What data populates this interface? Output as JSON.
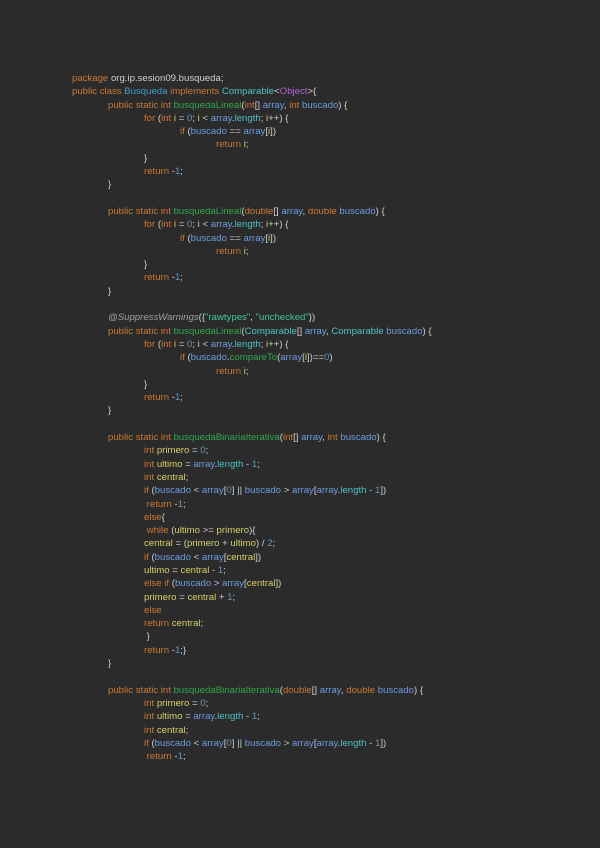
{
  "code_lines": [
    [
      [
        "k",
        "package "
      ],
      [
        "d",
        "org.ip.sesion09.busqueda;"
      ]
    ],
    [
      [
        "k",
        "public class "
      ],
      [
        "c",
        "Busqueda "
      ],
      [
        "k",
        "implements "
      ],
      [
        "t",
        "Comparable"
      ],
      [
        "d",
        "<"
      ],
      [
        "o",
        "Object"
      ],
      [
        "d",
        ">{"
      ]
    ],
    [
      [
        "k",
        "\tpublic static int "
      ],
      [
        "m",
        "busquedaLineal"
      ],
      [
        "d",
        "("
      ],
      [
        "k",
        "int"
      ],
      [
        "d",
        "[] "
      ],
      [
        "p",
        "array"
      ],
      [
        "d",
        ", "
      ],
      [
        "k",
        "int "
      ],
      [
        "p",
        "buscado"
      ],
      [
        "d",
        ") {"
      ]
    ],
    [
      [
        "k",
        "\t\tfor "
      ],
      [
        "d",
        "("
      ],
      [
        "k",
        "int "
      ],
      [
        "v",
        "i"
      ],
      [
        "d",
        " = "
      ],
      [
        "n",
        "0"
      ],
      [
        "d",
        "; "
      ],
      [
        "v",
        "i"
      ],
      [
        "d",
        " < "
      ],
      [
        "p",
        "array"
      ],
      [
        "d",
        "."
      ],
      [
        "f",
        "length"
      ],
      [
        "d",
        "; "
      ],
      [
        "v",
        "i"
      ],
      [
        "d",
        "++) {"
      ]
    ],
    [
      [
        "k",
        "\t\t\tif "
      ],
      [
        "d",
        "("
      ],
      [
        "p",
        "buscado"
      ],
      [
        "d",
        " == "
      ],
      [
        "p",
        "array"
      ],
      [
        "d",
        "["
      ],
      [
        "v",
        "i"
      ],
      [
        "d",
        "])"
      ]
    ],
    [
      [
        "k",
        "\t\t\t\treturn "
      ],
      [
        "v",
        "i"
      ],
      [
        "d",
        ";"
      ]
    ],
    [
      [
        "d",
        "\t\t}"
      ]
    ],
    [
      [
        "k",
        "\t\treturn "
      ],
      [
        "d",
        "-"
      ],
      [
        "n",
        "1"
      ],
      [
        "d",
        ";"
      ]
    ],
    [
      [
        "d",
        "\t}"
      ]
    ],
    [],
    [
      [
        "k",
        "\tpublic static int "
      ],
      [
        "m",
        "busquedaLineal"
      ],
      [
        "d",
        "("
      ],
      [
        "k",
        "double"
      ],
      [
        "d",
        "[] "
      ],
      [
        "p",
        "array"
      ],
      [
        "d",
        ", "
      ],
      [
        "k",
        "double "
      ],
      [
        "p",
        "buscado"
      ],
      [
        "d",
        ") {"
      ]
    ],
    [
      [
        "k",
        "\t\tfor "
      ],
      [
        "d",
        "("
      ],
      [
        "k",
        "int "
      ],
      [
        "v",
        "i"
      ],
      [
        "d",
        " = "
      ],
      [
        "n",
        "0"
      ],
      [
        "d",
        "; "
      ],
      [
        "v",
        "i"
      ],
      [
        "d",
        " < "
      ],
      [
        "p",
        "array"
      ],
      [
        "d",
        "."
      ],
      [
        "f",
        "length"
      ],
      [
        "d",
        "; "
      ],
      [
        "v",
        "i"
      ],
      [
        "d",
        "++) {"
      ]
    ],
    [
      [
        "k",
        "\t\t\tif "
      ],
      [
        "d",
        "("
      ],
      [
        "p",
        "buscado"
      ],
      [
        "d",
        " == "
      ],
      [
        "p",
        "array"
      ],
      [
        "d",
        "["
      ],
      [
        "v",
        "i"
      ],
      [
        "d",
        "])"
      ]
    ],
    [
      [
        "k",
        "\t\t\t\treturn "
      ],
      [
        "v",
        "i"
      ],
      [
        "d",
        ";"
      ]
    ],
    [
      [
        "d",
        "\t\t}"
      ]
    ],
    [
      [
        "k",
        "\t\treturn "
      ],
      [
        "d",
        "-"
      ],
      [
        "n",
        "1"
      ],
      [
        "d",
        ";"
      ]
    ],
    [
      [
        "d",
        "\t}"
      ]
    ],
    [],
    [
      [
        "a",
        "\t@SuppressWarnings"
      ],
      [
        "d",
        "({"
      ],
      [
        "s",
        "\"rawtypes\""
      ],
      [
        "d",
        ", "
      ],
      [
        "s",
        "\"unchecked\""
      ],
      [
        "d",
        "})"
      ]
    ],
    [
      [
        "k",
        "\tpublic static int "
      ],
      [
        "m",
        "busquedaLineal"
      ],
      [
        "d",
        "("
      ],
      [
        "t",
        "Comparable"
      ],
      [
        "d",
        "[] "
      ],
      [
        "p",
        "array"
      ],
      [
        "d",
        ", "
      ],
      [
        "t",
        "Comparable "
      ],
      [
        "p",
        "buscado"
      ],
      [
        "d",
        ") {"
      ]
    ],
    [
      [
        "k",
        "\t\tfor "
      ],
      [
        "d",
        "("
      ],
      [
        "k",
        "int "
      ],
      [
        "v",
        "i"
      ],
      [
        "d",
        " = "
      ],
      [
        "n",
        "0"
      ],
      [
        "d",
        "; "
      ],
      [
        "v",
        "i"
      ],
      [
        "d",
        " < "
      ],
      [
        "p",
        "array"
      ],
      [
        "d",
        "."
      ],
      [
        "f",
        "length"
      ],
      [
        "d",
        "; "
      ],
      [
        "v",
        "i"
      ],
      [
        "d",
        "++) {"
      ]
    ],
    [
      [
        "k",
        "\t\t\tif "
      ],
      [
        "d",
        "("
      ],
      [
        "p",
        "buscado"
      ],
      [
        "d",
        "."
      ],
      [
        "m",
        "compareTo"
      ],
      [
        "d",
        "("
      ],
      [
        "p",
        "array"
      ],
      [
        "d",
        "["
      ],
      [
        "v",
        "i"
      ],
      [
        "d",
        "])=="
      ],
      [
        "n",
        "0"
      ],
      [
        "d",
        ")"
      ]
    ],
    [
      [
        "k",
        "\t\t\t\treturn "
      ],
      [
        "v",
        "i"
      ],
      [
        "d",
        ";"
      ]
    ],
    [
      [
        "d",
        "\t\t}"
      ]
    ],
    [
      [
        "k",
        "\t\treturn "
      ],
      [
        "d",
        "-"
      ],
      [
        "n",
        "1"
      ],
      [
        "d",
        ";"
      ]
    ],
    [
      [
        "d",
        "\t}"
      ]
    ],
    [],
    [
      [
        "k",
        "\tpublic static int "
      ],
      [
        "m",
        "busquedaBinariaIterativa"
      ],
      [
        "d",
        "("
      ],
      [
        "k",
        "int"
      ],
      [
        "d",
        "[] "
      ],
      [
        "p",
        "array"
      ],
      [
        "d",
        ", "
      ],
      [
        "k",
        "int "
      ],
      [
        "p",
        "buscado"
      ],
      [
        "d",
        ") {"
      ]
    ],
    [
      [
        "k",
        "\t\tint "
      ],
      [
        "v",
        "primero"
      ],
      [
        "d",
        " = "
      ],
      [
        "n",
        "0"
      ],
      [
        "d",
        ";"
      ]
    ],
    [
      [
        "k",
        "\t\tint "
      ],
      [
        "v",
        "ultimo"
      ],
      [
        "d",
        " = "
      ],
      [
        "p",
        "array"
      ],
      [
        "d",
        "."
      ],
      [
        "f",
        "length"
      ],
      [
        "d",
        " - "
      ],
      [
        "n",
        "1"
      ],
      [
        "d",
        ";"
      ]
    ],
    [
      [
        "k",
        "\t\tint "
      ],
      [
        "v",
        "central"
      ],
      [
        "d",
        ";"
      ]
    ],
    [
      [
        "k",
        "\t\tif "
      ],
      [
        "d",
        "("
      ],
      [
        "p",
        "buscado"
      ],
      [
        "d",
        " < "
      ],
      [
        "p",
        "array"
      ],
      [
        "d",
        "["
      ],
      [
        "n",
        "0"
      ],
      [
        "d",
        "] || "
      ],
      [
        "p",
        "buscado"
      ],
      [
        "d",
        " > "
      ],
      [
        "p",
        "array"
      ],
      [
        "d",
        "["
      ],
      [
        "p",
        "array"
      ],
      [
        "d",
        "."
      ],
      [
        "f",
        "length"
      ],
      [
        "d",
        " - "
      ],
      [
        "n",
        "1"
      ],
      [
        "d",
        "])"
      ]
    ],
    [
      [
        "k",
        "\t\t return "
      ],
      [
        "d",
        "-"
      ],
      [
        "n",
        "1"
      ],
      [
        "d",
        ";"
      ]
    ],
    [
      [
        "k",
        "\t\telse"
      ],
      [
        "d",
        "{"
      ]
    ],
    [
      [
        "k",
        "\t\t while "
      ],
      [
        "d",
        "("
      ],
      [
        "v",
        "ultimo"
      ],
      [
        "d",
        " >= "
      ],
      [
        "v",
        "primero"
      ],
      [
        "d",
        "){"
      ]
    ],
    [
      [
        "v",
        "\t\tcentral"
      ],
      [
        "d",
        " = ("
      ],
      [
        "v",
        "primero"
      ],
      [
        "d",
        " + "
      ],
      [
        "v",
        "ultimo"
      ],
      [
        "d",
        ") / "
      ],
      [
        "n",
        "2"
      ],
      [
        "d",
        ";"
      ]
    ],
    [
      [
        "k",
        "\t\tif "
      ],
      [
        "d",
        "("
      ],
      [
        "p",
        "buscado"
      ],
      [
        "d",
        " < "
      ],
      [
        "p",
        "array"
      ],
      [
        "d",
        "["
      ],
      [
        "v",
        "central"
      ],
      [
        "d",
        "])"
      ]
    ],
    [
      [
        "v",
        "\t\tultimo"
      ],
      [
        "d",
        " = "
      ],
      [
        "v",
        "central"
      ],
      [
        "d",
        " - "
      ],
      [
        "n",
        "1"
      ],
      [
        "d",
        ";"
      ]
    ],
    [
      [
        "k",
        "\t\telse if "
      ],
      [
        "d",
        "("
      ],
      [
        "p",
        "buscado"
      ],
      [
        "d",
        " > "
      ],
      [
        "p",
        "array"
      ],
      [
        "d",
        "["
      ],
      [
        "v",
        "central"
      ],
      [
        "d",
        "])"
      ]
    ],
    [
      [
        "v",
        "\t\tprimero"
      ],
      [
        "d",
        " = "
      ],
      [
        "v",
        "central"
      ],
      [
        "d",
        " + "
      ],
      [
        "n",
        "1"
      ],
      [
        "d",
        ";"
      ]
    ],
    [
      [
        "k",
        "\t\telse"
      ]
    ],
    [
      [
        "k",
        "\t\treturn "
      ],
      [
        "v",
        "central"
      ],
      [
        "d",
        ";"
      ]
    ],
    [
      [
        "d",
        "\t\t }"
      ]
    ],
    [
      [
        "k",
        "\t\treturn "
      ],
      [
        "d",
        "-"
      ],
      [
        "n",
        "1"
      ],
      [
        "d",
        ";}"
      ]
    ],
    [
      [
        "d",
        "\t}"
      ]
    ],
    [],
    [
      [
        "k",
        "\tpublic static int "
      ],
      [
        "m",
        "busquedaBinariaIterativa"
      ],
      [
        "d",
        "("
      ],
      [
        "k",
        "double"
      ],
      [
        "d",
        "[] "
      ],
      [
        "p",
        "array"
      ],
      [
        "d",
        ", "
      ],
      [
        "k",
        "double "
      ],
      [
        "p",
        "buscado"
      ],
      [
        "d",
        ") {"
      ]
    ],
    [
      [
        "k",
        "\t\tint "
      ],
      [
        "v",
        "primero"
      ],
      [
        "d",
        " = "
      ],
      [
        "n",
        "0"
      ],
      [
        "d",
        ";"
      ]
    ],
    [
      [
        "k",
        "\t\tint "
      ],
      [
        "v",
        "ultimo"
      ],
      [
        "d",
        " = "
      ],
      [
        "p",
        "array"
      ],
      [
        "d",
        "."
      ],
      [
        "f",
        "length"
      ],
      [
        "d",
        " - "
      ],
      [
        "n",
        "1"
      ],
      [
        "d",
        ";"
      ]
    ],
    [
      [
        "k",
        "\t\tint "
      ],
      [
        "v",
        "central"
      ],
      [
        "d",
        ";"
      ]
    ],
    [
      [
        "k",
        "\t\tif "
      ],
      [
        "d",
        "("
      ],
      [
        "p",
        "buscado"
      ],
      [
        "d",
        " < "
      ],
      [
        "p",
        "array"
      ],
      [
        "d",
        "["
      ],
      [
        "n",
        "0"
      ],
      [
        "d",
        "] || "
      ],
      [
        "p",
        "buscado"
      ],
      [
        "d",
        " > "
      ],
      [
        "p",
        "array"
      ],
      [
        "d",
        "["
      ],
      [
        "p",
        "array"
      ],
      [
        "d",
        "."
      ],
      [
        "f",
        "length"
      ],
      [
        "d",
        " - "
      ],
      [
        "n",
        "1"
      ],
      [
        "d",
        "])"
      ]
    ],
    [
      [
        "k",
        "\t\t return "
      ],
      [
        "d",
        "-"
      ],
      [
        "n",
        "1"
      ],
      [
        "d",
        ";"
      ]
    ]
  ],
  "colors": {
    "background": "#2b2b2b",
    "keyword": "#cc7832",
    "method": "#2fa84a",
    "parameter": "#6d9ce0",
    "local": "#d4cf6a",
    "number": "#6897bb"
  }
}
